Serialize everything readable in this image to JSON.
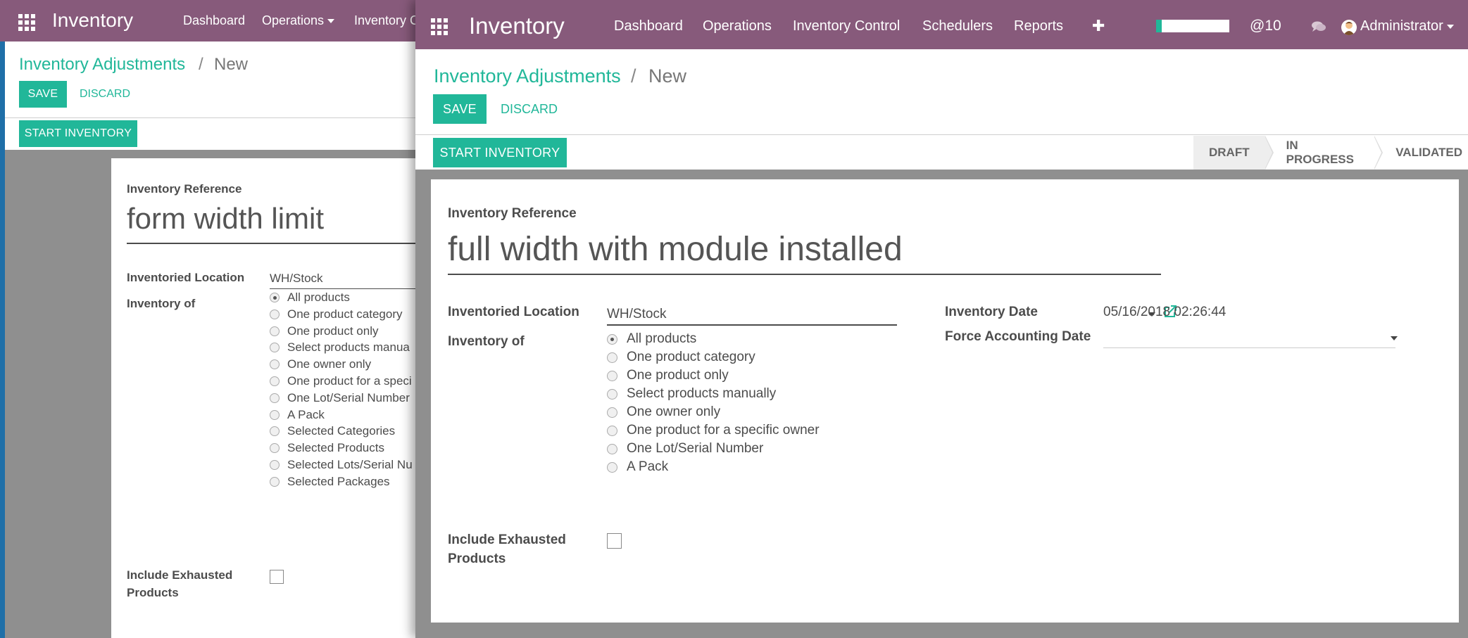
{
  "back_window": {
    "app_title": "Inventory",
    "nav": [
      "Dashboard",
      "Operations",
      "Inventory C"
    ],
    "breadcrumb": {
      "parent": "Inventory Adjustments",
      "sep": "/",
      "current": "New"
    },
    "save_label": "SAVE",
    "discard_label": "DISCARD",
    "start_label": "START INVENTORY",
    "ref_label": "Inventory Reference",
    "ref_value": "form width limit",
    "location_label": "Inventoried Location",
    "location_value": "WH/Stock",
    "inventory_of_label": "Inventory of",
    "options": [
      "All products",
      "One product category",
      "One product only",
      "Select products manua",
      "One owner only",
      "One product for a speci",
      "One Lot/Serial Number",
      "A Pack",
      "Selected Categories",
      "Selected Products",
      "Selected Lots/Serial Nu",
      "Selected Packages"
    ],
    "selected_index": 0,
    "exhausted_label_1": "Include Exhausted",
    "exhausted_label_2": "Products"
  },
  "front_window": {
    "app_title": "Inventory",
    "nav": [
      "Dashboard",
      "Operations",
      "Inventory Control",
      "Schedulers",
      "Reports"
    ],
    "plus": "✚",
    "mentions": "@10",
    "user": "Administrator",
    "breadcrumb": {
      "parent": "Inventory Adjustments",
      "sep": "/",
      "current": "New"
    },
    "save_label": "SAVE",
    "discard_label": "DISCARD",
    "start_label": "START INVENTORY",
    "stages": [
      "DRAFT",
      "IN PROGRESS",
      "VALIDATED"
    ],
    "ref_label": "Inventory Reference",
    "ref_value": "full width with module installed",
    "location_label": "Inventoried Location",
    "location_value": "WH/Stock",
    "inventory_of_label": "Inventory of",
    "options": [
      "All products",
      "One product category",
      "One product only",
      "Select products manually",
      "One owner only",
      "One product for a specific owner",
      "One Lot/Serial Number",
      "A Pack"
    ],
    "selected_index": 0,
    "exhausted_label_1": "Include Exhausted",
    "exhausted_label_2": "Products",
    "date_label": "Inventory Date",
    "date_value": "05/16/2018 02:26:44",
    "accounting_label": "Force Accounting Date",
    "accounting_value": ""
  },
  "colors": {
    "topbar": "#875a7b",
    "accent": "#21b799",
    "gray_bg": "#8f8f8f"
  }
}
